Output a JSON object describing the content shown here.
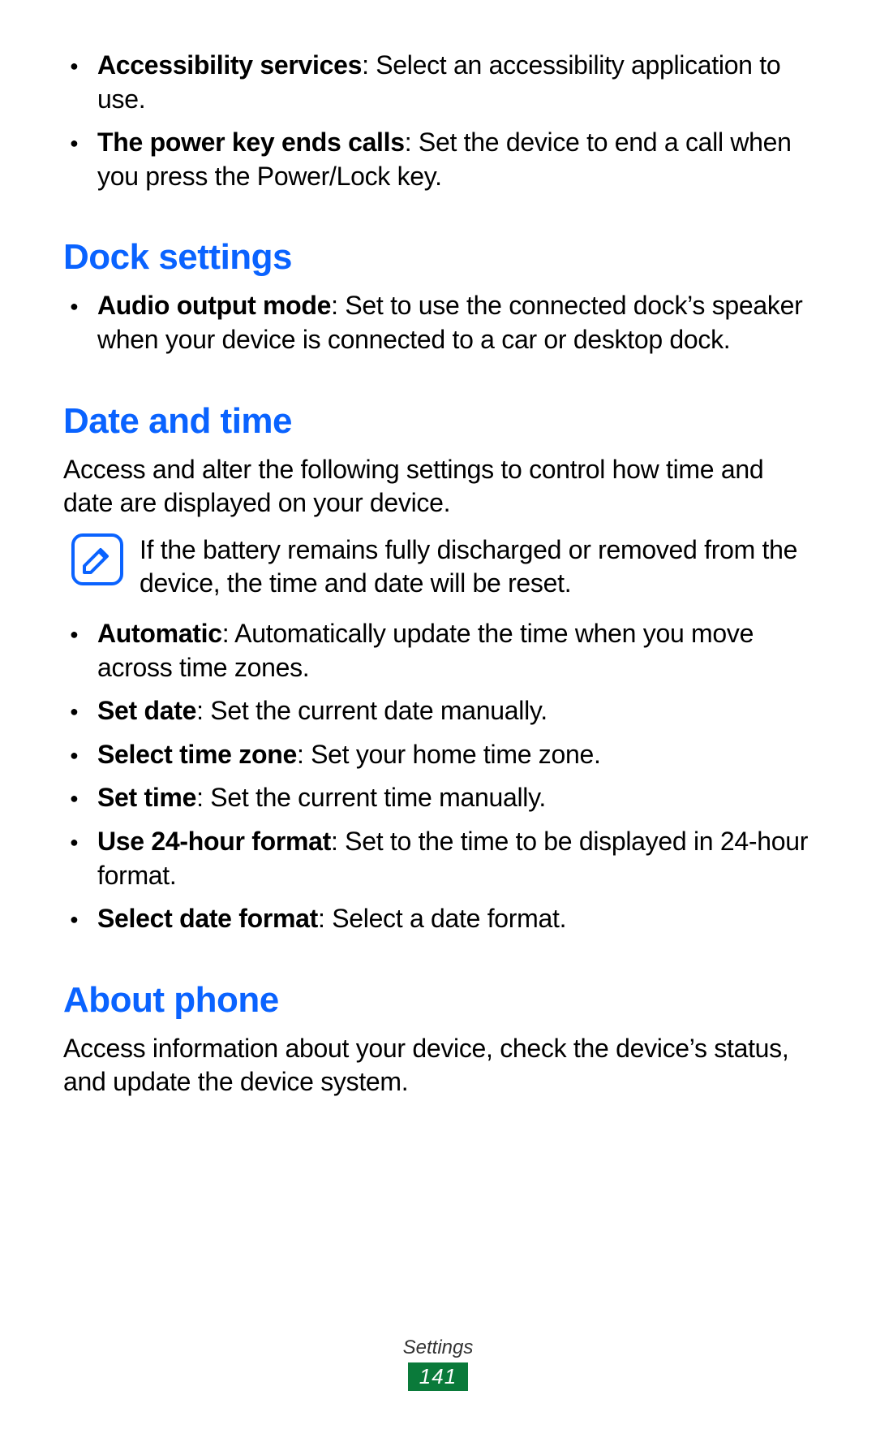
{
  "top_bullets": [
    {
      "label": "Accessibility services",
      "desc": ": Select an accessibility application to use."
    },
    {
      "label": "The power key ends calls",
      "desc": ": Set the device to end a call when you press the Power/Lock key."
    }
  ],
  "dock": {
    "heading": "Dock settings",
    "bullets": [
      {
        "label": "Audio output mode",
        "desc": ": Set to use the connected dock’s speaker when your device is connected to a car or desktop dock."
      }
    ]
  },
  "datetime": {
    "heading": "Date and time",
    "intro": "Access and alter the following settings to control how time and date are displayed on your device.",
    "note": "If the battery remains fully discharged or removed from the device, the time and date will be reset.",
    "bullets": [
      {
        "label": "Automatic",
        "desc": ": Automatically update the time when you move across time zones."
      },
      {
        "label": "Set date",
        "desc": ": Set the current date manually."
      },
      {
        "label": "Select time zone",
        "desc": ": Set your home time zone."
      },
      {
        "label": "Set time",
        "desc": ": Set the current time manually."
      },
      {
        "label": "Use 24-hour format",
        "desc": ": Set to the time to be displayed in 24-hour format."
      },
      {
        "label": "Select date format",
        "desc": ": Select a date format."
      }
    ]
  },
  "about": {
    "heading": "About phone",
    "intro": "Access information about your device, check the device’s status, and update the device system."
  },
  "footer": {
    "section": "Settings",
    "page": "141"
  }
}
